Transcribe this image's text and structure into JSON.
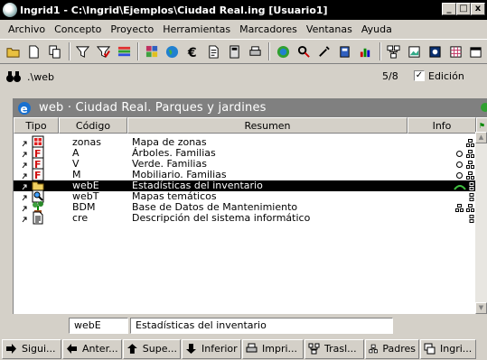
{
  "window": {
    "title": "Ingrid1 - C:\\Ingrid\\Ejemplos\\Ciudad Real.ing   [Usuario1]",
    "minimize": "_",
    "restore": "□",
    "close": "x"
  },
  "menu": [
    "Archivo",
    "Concepto",
    "Proyecto",
    "Herramientas",
    "Marcadores",
    "Ventanas",
    "Ayuda"
  ],
  "toolbar_icons": [
    "open-folder-icon",
    "new-document-icon",
    "copy-icon",
    "filter-icon",
    "filter-check-icon",
    "rainbow-icon",
    "palette-icon",
    "globe-icon",
    "euro-icon",
    "document-icon",
    "calculator-icon",
    "printer-icon",
    "world-icon",
    "search-tools-icon",
    "wrench-icon",
    "database-icon",
    "chart-icon",
    "network-icon",
    "document-image-icon",
    "image-icon",
    "table-icon",
    "window-icon"
  ],
  "path": {
    "text": ".\\web",
    "count": "5/8",
    "edit_checked": "✓",
    "edit_label": "Edición"
  },
  "section": {
    "title": "web · Ciudad Real. Parques y jardines"
  },
  "columns": {
    "tipo": "Tipo",
    "codigo": "Código",
    "resumen": "Resumen",
    "info": "Info"
  },
  "rows": [
    {
      "code": "zonas",
      "summary": "Mapa de zonas",
      "icon": "map-icon"
    },
    {
      "code": "A",
      "summary": "Árboles. Familias",
      "icon": "family-icon"
    },
    {
      "code": "V",
      "summary": "Verde. Familias",
      "icon": "family-icon"
    },
    {
      "code": "M",
      "summary": "Mobiliario. Familias",
      "icon": "family-icon"
    },
    {
      "code": "webE",
      "summary": "Estadísticas del inventario",
      "icon": "folder-icon"
    },
    {
      "code": "webT",
      "summary": "Mapas temáticos",
      "icon": "search-doc-icon"
    },
    {
      "code": "BDM",
      "summary": "Base de Datos de Mantenimiento",
      "icon": "plant-icon"
    },
    {
      "code": "cre",
      "summary": "Descripción del sistema informático",
      "icon": "text-doc-icon"
    }
  ],
  "selected_index": 4,
  "edit": {
    "code": "webE",
    "summary": "Estadísticas del inventario"
  },
  "nav": [
    {
      "label": "Sigui...",
      "icon": "arrow-right-icon"
    },
    {
      "label": "Anter...",
      "icon": "arrow-left-icon"
    },
    {
      "label": "Supe...",
      "icon": "arrow-up-icon"
    },
    {
      "label": "Inferior",
      "icon": "arrow-down-icon"
    },
    {
      "label": "Impri...",
      "icon": "printer-icon"
    },
    {
      "label": "Trasl...",
      "icon": "network-icon"
    },
    {
      "label": "Padres",
      "icon": "tree-icon"
    },
    {
      "label": "Ingri...",
      "icon": "windows-icon"
    }
  ],
  "colors": {
    "title_bar": "#000000",
    "band": "#808080",
    "selection": "#000000",
    "face": "#d4d0c8"
  }
}
